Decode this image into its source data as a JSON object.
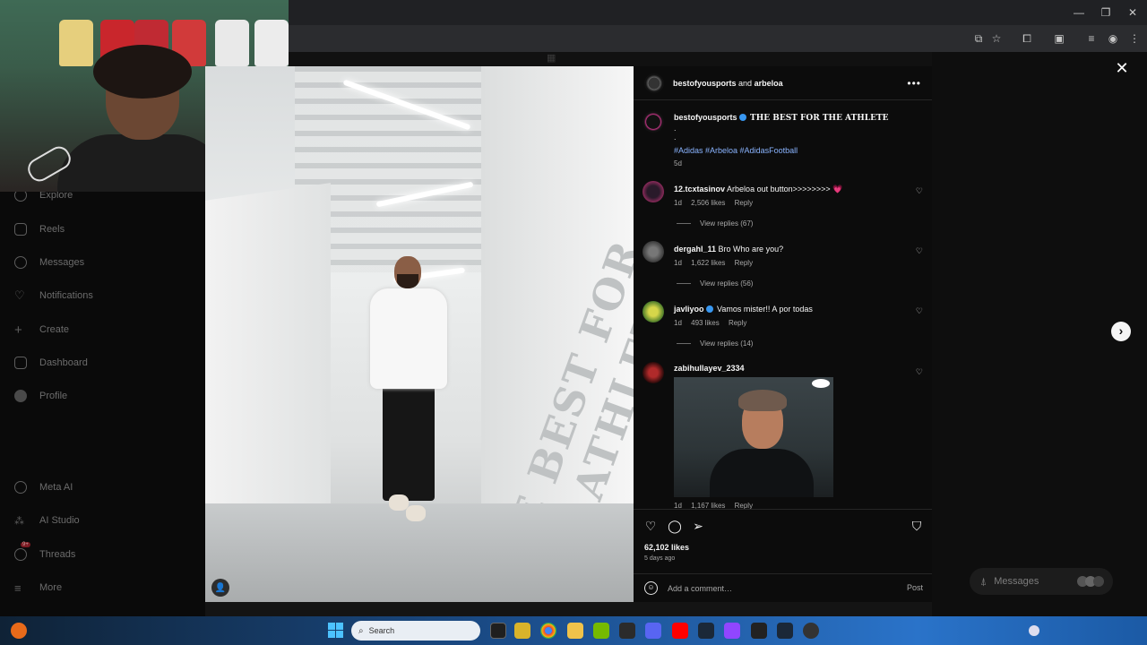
{
  "window": {
    "minimize_icon": "minimize-icon",
    "maximize_icon": "restore-icon",
    "close_icon": "close-icon"
  },
  "sidebar": {
    "items": [
      {
        "label": "Explore",
        "icon": "compass-icon"
      },
      {
        "label": "Reels",
        "icon": "reels-icon"
      },
      {
        "label": "Messages",
        "icon": "messenger-icon"
      },
      {
        "label": "Notifications",
        "icon": "heart-icon"
      },
      {
        "label": "Create",
        "icon": "plus-icon"
      },
      {
        "label": "Dashboard",
        "icon": "dashboard-icon"
      },
      {
        "label": "Profile",
        "icon": "profile-icon"
      },
      {
        "label": "Meta AI",
        "icon": "meta-ai-icon"
      },
      {
        "label": "AI Studio",
        "icon": "ai-studio-icon"
      },
      {
        "label": "Threads",
        "icon": "threads-icon",
        "badge": "9+"
      },
      {
        "label": "More",
        "icon": "menu-icon"
      }
    ]
  },
  "photo": {
    "wall_text": "THE BEST FOR THE ATHLETE"
  },
  "post": {
    "header": {
      "user": "bestofyousports",
      "and": "and",
      "collab": "arbeloa"
    },
    "caption": {
      "user": "bestofyousports",
      "text": "THE BEST FOR THE ATHLETE",
      "dot": ".",
      "hashtags": "#Adidas #Arbeloa #AdidasFootball",
      "time": "5d"
    },
    "comments": [
      {
        "user": "12.tcxtasinov",
        "text": "Arbeloa out button>>>>>>>> 💗",
        "time": "1d",
        "likes": "2,506 likes",
        "reply": "Reply",
        "view_replies": "View replies (67)"
      },
      {
        "user": "dergahl_11",
        "text": "Bro Who are you?",
        "time": "1d",
        "likes": "1,622 likes",
        "reply": "Reply",
        "view_replies": "View replies (56)"
      },
      {
        "user": "javliyoo",
        "text": "Vamos mister!! A por todas",
        "time": "1d",
        "likes": "493 likes",
        "reply": "Reply",
        "view_replies": "View replies (14)"
      },
      {
        "user": "zabihullayev_2334",
        "text": "",
        "time": "1d",
        "likes": "1,167 likes",
        "reply": "Reply"
      }
    ],
    "likes": "62,102 likes",
    "posted_ago": "5 days ago",
    "comment_placeholder": "Add a comment…",
    "post_button": "Post"
  },
  "floating": {
    "messages_label": "Messages"
  },
  "taskbar": {
    "search_placeholder": "Search"
  },
  "colors": {
    "accent": "#3897f0",
    "hashtag": "#8ab4ff",
    "panel_bg": "#0c0c0c"
  }
}
